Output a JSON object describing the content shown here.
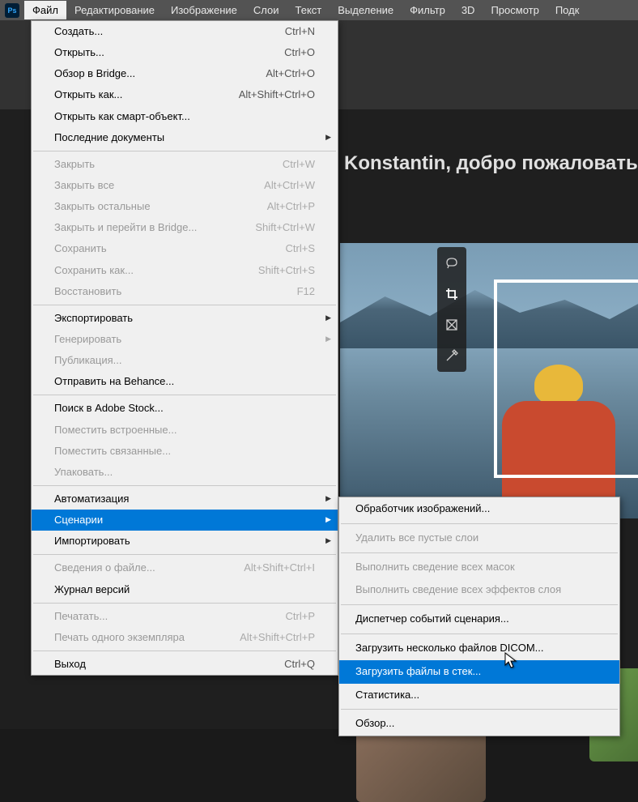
{
  "menubar": {
    "items": [
      "Файл",
      "Редактирование",
      "Изображение",
      "Слои",
      "Текст",
      "Выделение",
      "Фильтр",
      "3D",
      "Просмотр",
      "Подк"
    ]
  },
  "welcome": "Konstantin, добро пожаловать в Ph",
  "file_menu": [
    {
      "label": "Создать...",
      "shortcut": "Ctrl+N"
    },
    {
      "label": "Открыть...",
      "shortcut": "Ctrl+O"
    },
    {
      "label": "Обзор в Bridge...",
      "shortcut": "Alt+Ctrl+O"
    },
    {
      "label": "Открыть как...",
      "shortcut": "Alt+Shift+Ctrl+O"
    },
    {
      "label": "Открыть как смарт-объект..."
    },
    {
      "label": "Последние документы",
      "submenu": true
    },
    {
      "sep": true
    },
    {
      "label": "Закрыть",
      "shortcut": "Ctrl+W",
      "disabled": true
    },
    {
      "label": "Закрыть все",
      "shortcut": "Alt+Ctrl+W",
      "disabled": true
    },
    {
      "label": "Закрыть остальные",
      "shortcut": "Alt+Ctrl+P",
      "disabled": true
    },
    {
      "label": "Закрыть и перейти в Bridge...",
      "shortcut": "Shift+Ctrl+W",
      "disabled": true
    },
    {
      "label": "Сохранить",
      "shortcut": "Ctrl+S",
      "disabled": true
    },
    {
      "label": "Сохранить как...",
      "shortcut": "Shift+Ctrl+S",
      "disabled": true
    },
    {
      "label": "Восстановить",
      "shortcut": "F12",
      "disabled": true
    },
    {
      "sep": true
    },
    {
      "label": "Экспортировать",
      "submenu": true
    },
    {
      "label": "Генерировать",
      "submenu": true,
      "disabled": true
    },
    {
      "label": "Публикация...",
      "disabled": true
    },
    {
      "label": "Отправить на Behance..."
    },
    {
      "sep": true
    },
    {
      "label": "Поиск в Adobe Stock..."
    },
    {
      "label": "Поместить встроенные...",
      "disabled": true
    },
    {
      "label": "Поместить связанные...",
      "disabled": true
    },
    {
      "label": "Упаковать...",
      "disabled": true
    },
    {
      "sep": true
    },
    {
      "label": "Автоматизация",
      "submenu": true
    },
    {
      "label": "Сценарии",
      "submenu": true,
      "highlighted": true
    },
    {
      "label": "Импортировать",
      "submenu": true
    },
    {
      "sep": true
    },
    {
      "label": "Сведения о файле...",
      "shortcut": "Alt+Shift+Ctrl+I",
      "disabled": true
    },
    {
      "label": "Журнал версий"
    },
    {
      "sep": true
    },
    {
      "label": "Печатать...",
      "shortcut": "Ctrl+P",
      "disabled": true
    },
    {
      "label": "Печать одного экземпляра",
      "shortcut": "Alt+Shift+Ctrl+P",
      "disabled": true
    },
    {
      "sep": true
    },
    {
      "label": "Выход",
      "shortcut": "Ctrl+Q"
    }
  ],
  "scripts_submenu": [
    {
      "label": "Обработчик изображений..."
    },
    {
      "sep": true
    },
    {
      "label": "Удалить все пустые слои",
      "disabled": true
    },
    {
      "sep": true
    },
    {
      "label": "Выполнить сведение всех масок",
      "disabled": true
    },
    {
      "label": "Выполнить сведение всех эффектов слоя",
      "disabled": true
    },
    {
      "sep": true
    },
    {
      "label": "Диспетчер событий сценария..."
    },
    {
      "sep": true
    },
    {
      "label": "Загрузить несколько файлов DICOM..."
    },
    {
      "label": "Загрузить файлы в стек...",
      "highlighted": true
    },
    {
      "label": "Статистика..."
    },
    {
      "sep": true
    },
    {
      "label": "Обзор..."
    }
  ]
}
